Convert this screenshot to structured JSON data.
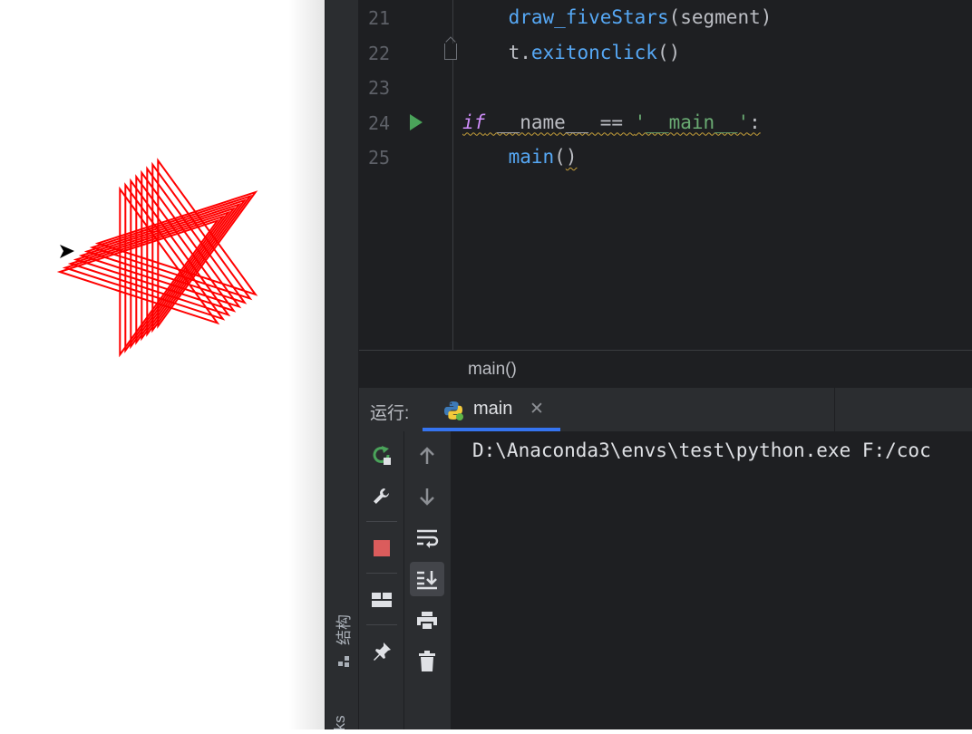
{
  "editor": {
    "lines": [
      {
        "number": "21",
        "indent": "    ",
        "parts": [
          {
            "text": "draw_fiveStars",
            "cls": "fn"
          },
          {
            "text": "(segment)",
            "cls": ""
          }
        ]
      },
      {
        "number": "22",
        "indent": "    ",
        "parts": [
          {
            "text": "t.",
            "cls": ""
          },
          {
            "text": "exitonclick",
            "cls": "fn"
          },
          {
            "text": "()",
            "cls": ""
          }
        ]
      },
      {
        "number": "23",
        "indent": "",
        "parts": []
      },
      {
        "number": "24",
        "indent": "",
        "parts": [
          {
            "text": "if",
            "cls": "kw squig"
          },
          {
            "text": " __name__ == ",
            "cls": "squig"
          },
          {
            "text": "'__main__'",
            "cls": "str squig"
          },
          {
            "text": ":",
            "cls": "squig"
          }
        ]
      },
      {
        "number": "25",
        "indent": "    ",
        "parts": [
          {
            "text": "main",
            "cls": "fn"
          },
          {
            "text": "(",
            "cls": ""
          },
          {
            "text": ")",
            "cls": "squig"
          }
        ]
      }
    ]
  },
  "breadcrumb": "main()",
  "run_panel": {
    "label": "运行:",
    "tab_label": "main",
    "tab_close": "✕",
    "console_output": "D:\\Anaconda3\\envs\\test\\python.exe F:/coc"
  },
  "side_strip": {
    "structure_label": "结构",
    "bookmarks_label": "rks"
  },
  "colors": {
    "star_stroke": "#ff0000",
    "rerun": "#4aa35a",
    "stop": "#db5c5c",
    "accent": "#3574f0"
  },
  "icons": {
    "run_toolbar": [
      "rerun-icon",
      "wrench-icon",
      "stop-icon",
      "layout-icon",
      "pin-icon"
    ],
    "sub_toolbar": [
      "arrow-up-icon",
      "arrow-down-icon",
      "soft-wrap-icon",
      "scroll-to-end-icon",
      "print-icon",
      "trash-icon"
    ]
  }
}
